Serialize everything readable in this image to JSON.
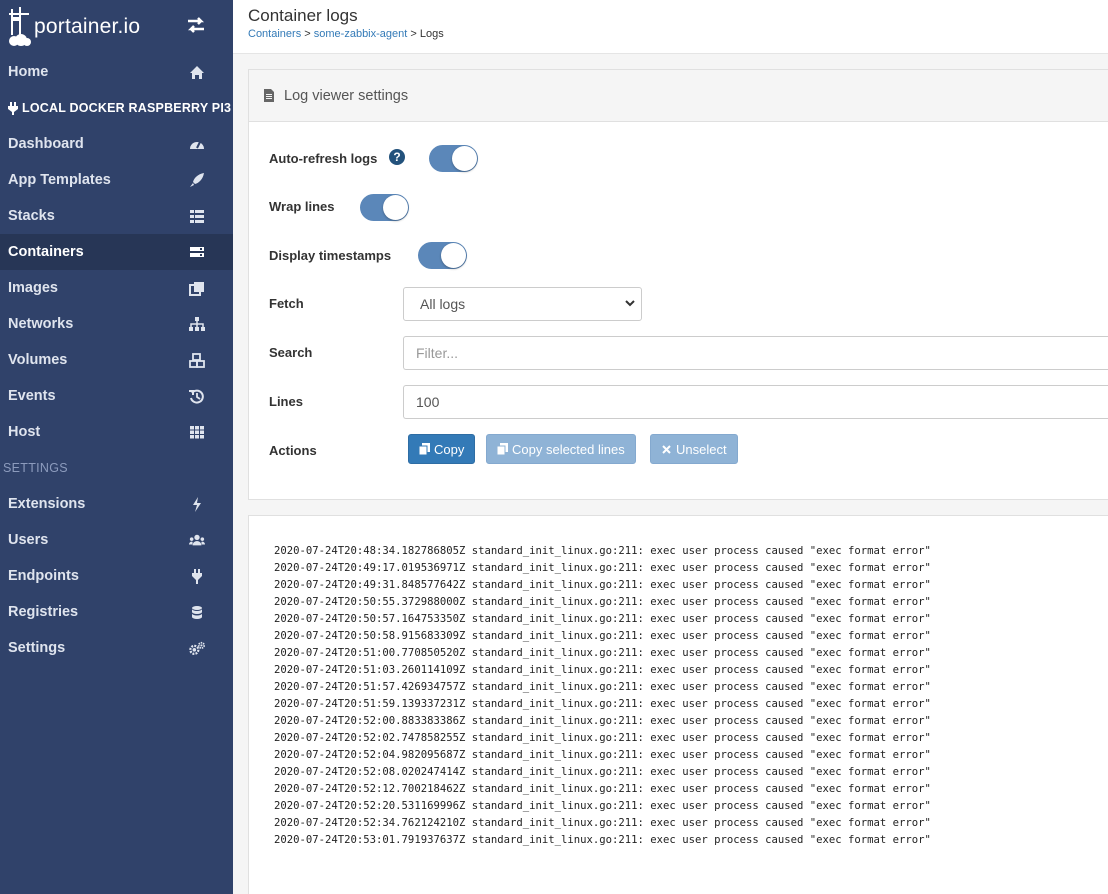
{
  "brand": {
    "name": "portainer.io"
  },
  "sidebar": {
    "top_items": [
      {
        "label": "Home",
        "icon": "home-icon"
      }
    ],
    "endpoint_label": "LOCAL DOCKER RASPBERRY PI3",
    "endpoint_items": [
      {
        "label": "Dashboard",
        "icon": "tachometer-icon"
      },
      {
        "label": "App Templates",
        "icon": "rocket-icon"
      },
      {
        "label": "Stacks",
        "icon": "th-list-icon"
      },
      {
        "label": "Containers",
        "icon": "server-icon",
        "active": true
      },
      {
        "label": "Images",
        "icon": "clone-icon"
      },
      {
        "label": "Networks",
        "icon": "sitemap-icon"
      },
      {
        "label": "Volumes",
        "icon": "cubes-icon"
      },
      {
        "label": "Events",
        "icon": "history-icon"
      },
      {
        "label": "Host",
        "icon": "th-icon"
      }
    ],
    "settings_label": "SETTINGS",
    "settings_items": [
      {
        "label": "Extensions",
        "icon": "bolt-icon"
      },
      {
        "label": "Users",
        "icon": "users-icon"
      },
      {
        "label": "Endpoints",
        "icon": "plug-icon"
      },
      {
        "label": "Registries",
        "icon": "database-icon"
      },
      {
        "label": "Settings",
        "icon": "cogs-icon"
      }
    ]
  },
  "header": {
    "title": "Container logs",
    "breadcrumb": {
      "containers": "Containers",
      "sep": ">",
      "container": "some-zabbix-agent",
      "current": "Logs"
    }
  },
  "settings": {
    "title": "Log viewer settings",
    "auto_refresh_label": "Auto-refresh logs",
    "auto_refresh": true,
    "wrap_label": "Wrap lines",
    "wrap": true,
    "timestamps_label": "Display timestamps",
    "timestamps": true,
    "fetch_label": "Fetch",
    "fetch_value": "All logs",
    "search_label": "Search",
    "search_placeholder": "Filter...",
    "lines_label": "Lines",
    "lines_value": "100",
    "actions_label": "Actions",
    "copy_label": "Copy",
    "copy_selected_label": "Copy selected lines",
    "unselect_label": "Unselect"
  },
  "colors": {
    "sidebar": "#30426a",
    "primary": "#337ab7",
    "toggle_on": "#5b87b9"
  },
  "logs": [
    "2020-07-24T20:48:34.182786805Z standard_init_linux.go:211: exec user process caused \"exec format error\"",
    "2020-07-24T20:49:17.019536971Z standard_init_linux.go:211: exec user process caused \"exec format error\"",
    "2020-07-24T20:49:31.848577642Z standard_init_linux.go:211: exec user process caused \"exec format error\"",
    "2020-07-24T20:50:55.372988000Z standard_init_linux.go:211: exec user process caused \"exec format error\"",
    "2020-07-24T20:50:57.164753350Z standard_init_linux.go:211: exec user process caused \"exec format error\"",
    "2020-07-24T20:50:58.915683309Z standard_init_linux.go:211: exec user process caused \"exec format error\"",
    "2020-07-24T20:51:00.770850520Z standard_init_linux.go:211: exec user process caused \"exec format error\"",
    "2020-07-24T20:51:03.260114109Z standard_init_linux.go:211: exec user process caused \"exec format error\"",
    "2020-07-24T20:51:57.426934757Z standard_init_linux.go:211: exec user process caused \"exec format error\"",
    "2020-07-24T20:51:59.139337231Z standard_init_linux.go:211: exec user process caused \"exec format error\"",
    "2020-07-24T20:52:00.883383386Z standard_init_linux.go:211: exec user process caused \"exec format error\"",
    "2020-07-24T20:52:02.747858255Z standard_init_linux.go:211: exec user process caused \"exec format error\"",
    "2020-07-24T20:52:04.982095687Z standard_init_linux.go:211: exec user process caused \"exec format error\"",
    "2020-07-24T20:52:08.020247414Z standard_init_linux.go:211: exec user process caused \"exec format error\"",
    "2020-07-24T20:52:12.700218462Z standard_init_linux.go:211: exec user process caused \"exec format error\"",
    "2020-07-24T20:52:20.531169996Z standard_init_linux.go:211: exec user process caused \"exec format error\"",
    "2020-07-24T20:52:34.762124210Z standard_init_linux.go:211: exec user process caused \"exec format error\"",
    "2020-07-24T20:53:01.791937637Z standard_init_linux.go:211: exec user process caused \"exec format error\""
  ]
}
